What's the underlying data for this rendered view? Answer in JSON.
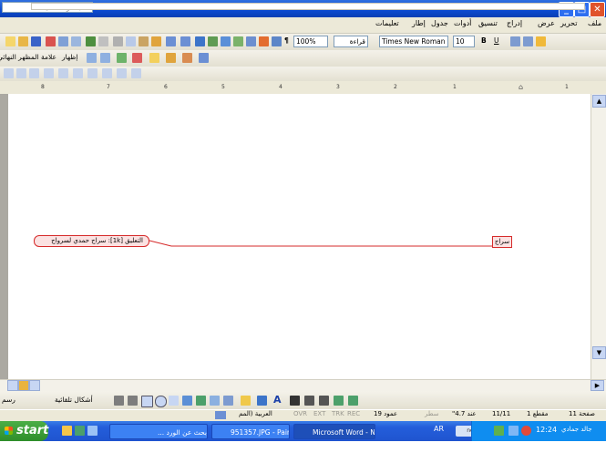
{
  "window": {
    "title": "Microsoft Word - New Microsoft Word Document.doc"
  },
  "menu": {
    "items": [
      "ملف",
      "تحرير",
      "عرض",
      "إدراج",
      "تنسيق",
      "أدوات",
      "جدول",
      "إطار",
      "تعليمات"
    ],
    "ask_placeholder": "اكتب سؤالاً للتعليمات"
  },
  "formatting": {
    "font": "Times New Roman",
    "size": "10",
    "zoom": "100%",
    "read_label": "قراءة",
    "bold": "B",
    "underline": "U"
  },
  "reviewing": {
    "show_label": "إظهار",
    "markup_view": "علامة المظهر النهائي"
  },
  "ruler": {
    "numbers": [
      "8",
      "7",
      "6",
      "5",
      "4",
      "3",
      "2",
      "1",
      "1"
    ]
  },
  "comment": {
    "balloon_text": "التعليق [1k]: سراج حمدي لسرواج",
    "anchor_text": "سراج"
  },
  "drawing": {
    "draw_label": "رسم",
    "autoshapes_label": "أشكال تلقائية"
  },
  "status": {
    "page": "صفحة 11",
    "section": "مقطع 1",
    "pages": "11/11",
    "at": "عند 4.7\"",
    "line": "سطر",
    "col": "عمود 19",
    "rec": "REC",
    "trk": "TRK",
    "ext": "EXT",
    "ovr": "OVR",
    "language": "العربية (المم"
  },
  "taskbar": {
    "start": "start",
    "tasks": [
      "بحث عن الورد ...",
      "951357.JPG - Paint",
      "Microsoft Word - New..."
    ],
    "lang": "AR",
    "clock": "12:24",
    "user": "جالد جمادي"
  }
}
